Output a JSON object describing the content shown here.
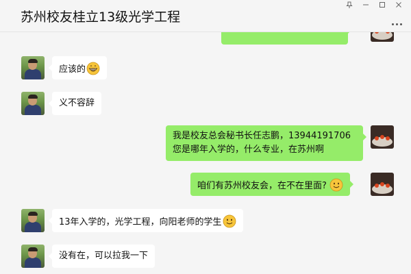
{
  "chat": {
    "title": "苏州校友桂立13级光学工程"
  },
  "window_controls": {
    "pin_icon": "pin-icon",
    "minimize_icon": "minimize-icon",
    "maximize_icon": "maximize-icon",
    "close_icon": "close-icon",
    "more_icon": "more-options-icon"
  },
  "messages": [
    {
      "sender": "friend",
      "text": "应该的",
      "emoji": "grin"
    },
    {
      "sender": "friend",
      "text": "义不容辞"
    },
    {
      "sender": "me",
      "lines": [
        "我是校友总会秘书长任志鹏，13944191706",
        "您是哪年入学的，什么专业，在苏州啊"
      ]
    },
    {
      "sender": "me",
      "text": "咱们有苏州校友会，在不在里面?",
      "emoji": "smile"
    },
    {
      "sender": "friend",
      "text": "13年入学的，光学工程，向阳老师的学生",
      "emoji": "smile"
    },
    {
      "sender": "friend",
      "text": "没有在，可以拉我一下"
    }
  ],
  "colors": {
    "outgoing_bubble": "#95ec69",
    "incoming_bubble": "#ffffff",
    "background": "#f5f5f5"
  }
}
